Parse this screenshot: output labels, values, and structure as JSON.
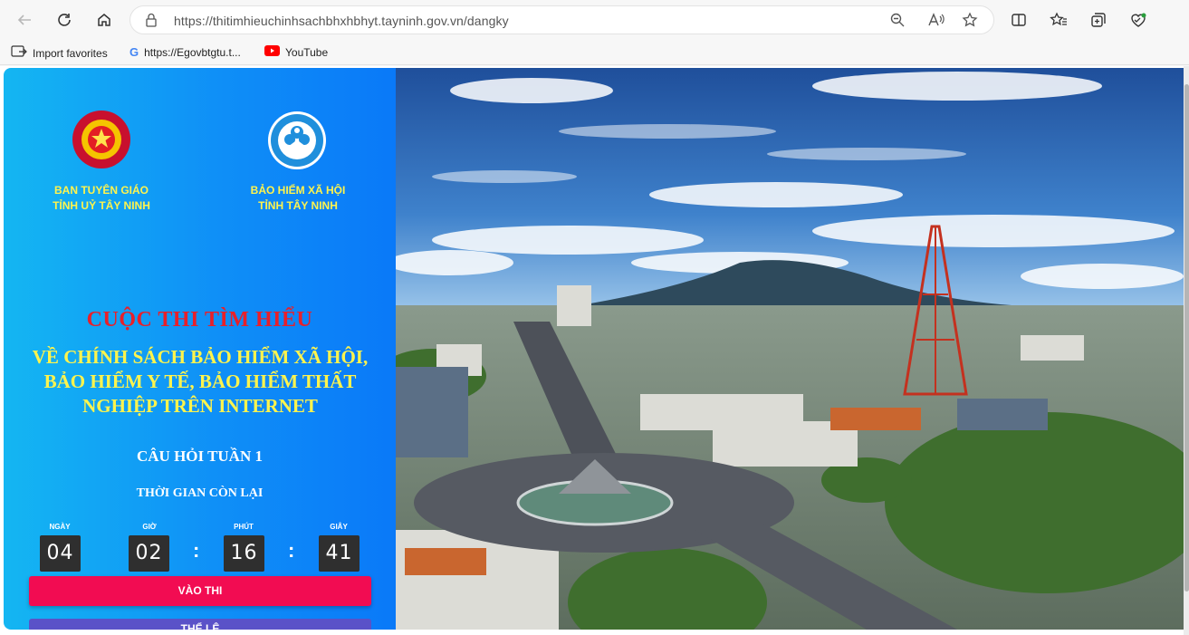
{
  "browser": {
    "url": "https://thitimhieuchinhsachbhxhbhyt.tayninh.gov.vn/dangky",
    "favorites": [
      {
        "label": "Import favorites",
        "icon": "import-icon"
      },
      {
        "label": "https://Egovbtgtu.t...",
        "icon": "google-icon"
      },
      {
        "label": "YouTube",
        "icon": "youtube-icon"
      }
    ]
  },
  "page": {
    "org_left": {
      "line1": "BAN TUYÊN GIÁO",
      "line2": "TỈNH UỶ TÂY NINH",
      "badge_top": "VÌ SỰ NGHIỆP",
      "badge_bottom": "TUYÊN GIÁO"
    },
    "org_right": {
      "line1": "BẢO HIỂM XÃ HỘI",
      "line2": "TỈNH TÂY NINH",
      "ring_text": "BẢO HIỂM XÃ HỘI VIỆT NAM"
    },
    "title_main": "CUỘC THI TÌM HIỂU",
    "title_sub": "VỀ CHÍNH SÁCH BẢO HIỂM XÃ HỘI, BẢO HIỂM Y TẾ, BẢO HIỂM THẤT NGHIỆP TRÊN INTERNET",
    "week": "CÂU HỎI TUẦN 1",
    "time_left_label": "THỜI GIAN CÒN LẠI",
    "countdown": {
      "days_label": "NGÀY",
      "days": "04",
      "hours_label": "GIỜ",
      "hours": "02",
      "minutes_label": "PHÚT",
      "minutes": "16",
      "seconds_label": "GIÂY",
      "seconds": "41"
    },
    "start_button": "VÀO THI",
    "second_button": "THỂ LỆ"
  },
  "colors": {
    "panel_gradient_start": "#14b6f2",
    "panel_gradient_end": "#0a79f8",
    "title_red": "#e8202a",
    "title_yellow": "#fff44d",
    "start_button": "#f20c52",
    "second_button": "#5a52c8"
  }
}
